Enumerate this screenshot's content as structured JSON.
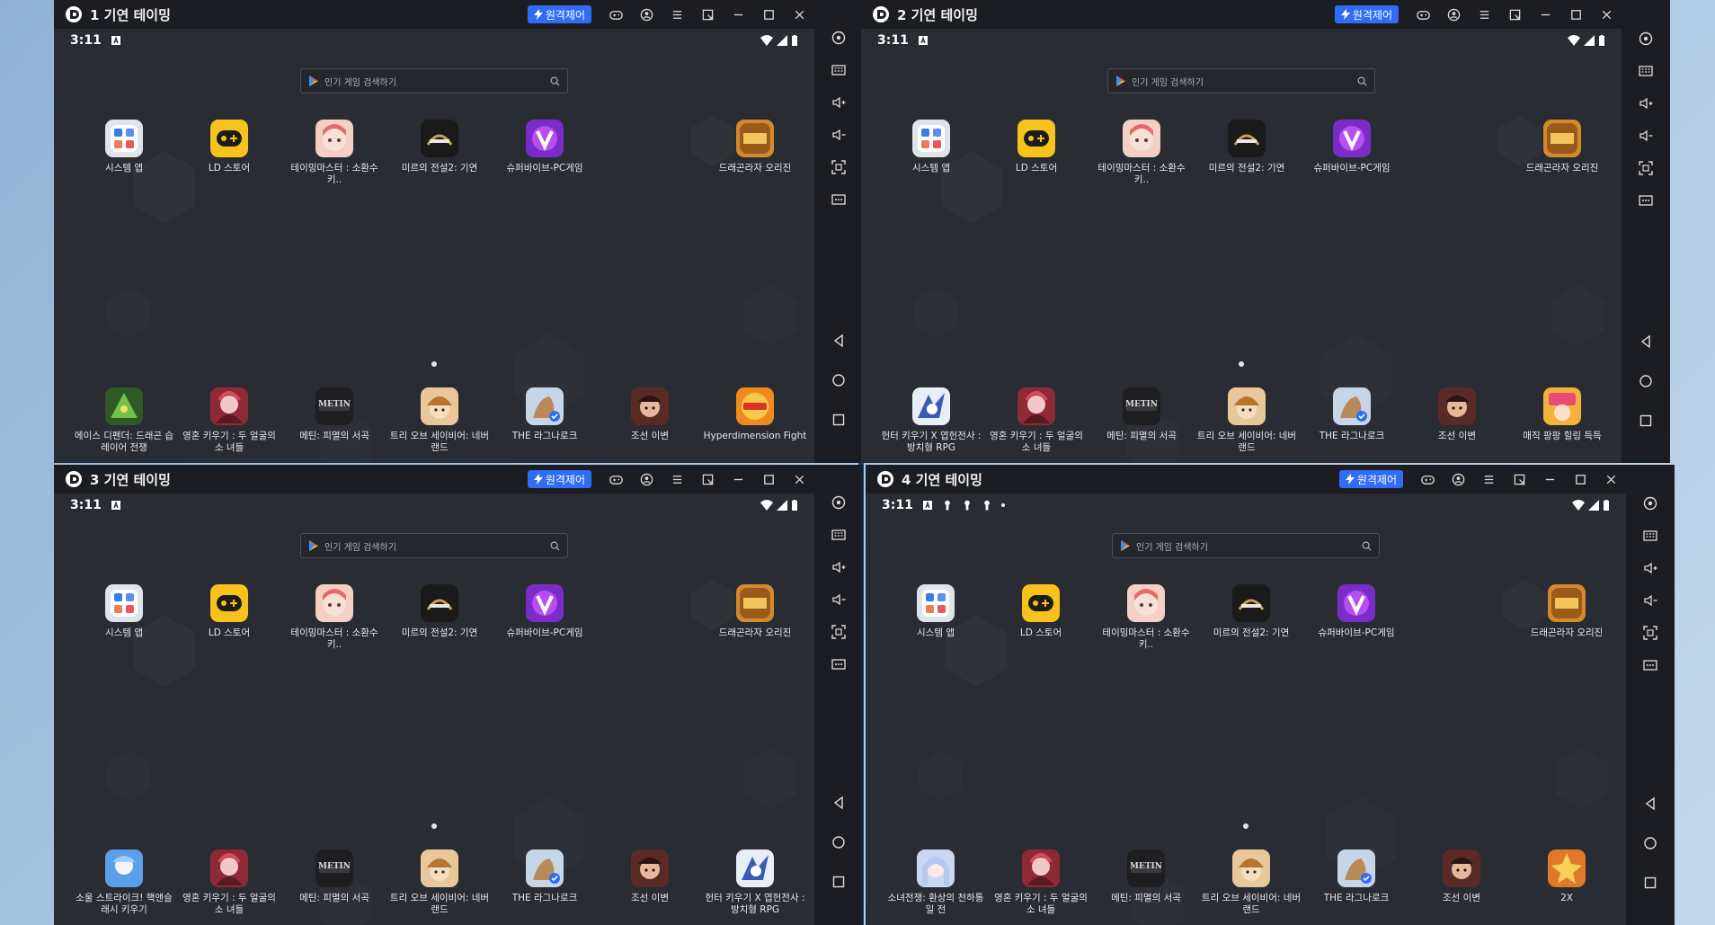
{
  "windows": [
    {
      "title": "1 기연 테이밍",
      "remote_label": "원격제어",
      "time": "3:11",
      "search_placeholder": "인기 게임 검색하기",
      "top_apps": [
        "시스템 앱",
        "LD 스토어",
        "테이밍마스터 : 소환수 키..",
        "미르의 전설2: 기연",
        "슈퍼바이브-PC게임",
        "드래곤라자 오리진"
      ],
      "dock_apps": [
        "에이스 디펜더: 드래곤 습 레이어 전쟁",
        "영혼 키우기 : 두 얼굴의 소 녀들",
        "메틴: 피멸의 서곡",
        "트리 오브 세이비어: 네버 랜드",
        "THE 라그나로크",
        "조선 이변",
        "Hyperdimension Fight"
      ],
      "dock_icons": [
        "dragon",
        "soul",
        "metin",
        "tree",
        "rag",
        "joseon",
        "hyper"
      ]
    },
    {
      "title": "2 기연 테이밍",
      "remote_label": "원격제어",
      "time": "3:11",
      "search_placeholder": "인기 게임 검색하기",
      "top_apps": [
        "시스템 앱",
        "LD 스토어",
        "테이밍마스터 : 소환수 키..",
        "미르의 전설2: 기연",
        "슈퍼바이브-PC게임",
        "드래곤라자 오리진"
      ],
      "dock_apps": [
        "헌터 키우기 X 엽헌전사 : 방치형 RPG",
        "영혼 키우기 : 두 얼굴의 소 녀들",
        "메틴: 피멸의 서곡",
        "트리 오브 세이비어: 네버 랜드",
        "THE 라그나로크",
        "조선 이변",
        "매직 팡팡 힐링 득득"
      ],
      "dock_icons": [
        "hunter",
        "soul",
        "metin",
        "tree",
        "rag",
        "joseon",
        "magic"
      ]
    },
    {
      "title": "3 기연 테이밍",
      "remote_label": "원격제어",
      "time": "3:11",
      "search_placeholder": "인기 게임 검색하기",
      "top_apps": [
        "시스템 앱",
        "LD 스토어",
        "테이밍마스터 : 소환수 키..",
        "미르의 전설2: 기연",
        "슈퍼바이브-PC게임",
        "드래곤라자 오리진"
      ],
      "dock_apps": [
        "소울 스트라이크! 핵앤슬 래시 키우기",
        "영혼 키우기 : 두 얼굴의 소 녀들",
        "메틴: 피멸의 서곡",
        "트리 오브 세이비어: 네버 랜드",
        "THE 라그나로크",
        "조선 이변",
        "헌터 키우기 X 엽헌전사 : 방치형 RPG"
      ],
      "dock_icons": [
        "soulstrike",
        "soul",
        "metin",
        "tree",
        "rag",
        "joseon",
        "hunter"
      ]
    },
    {
      "title": "4 기연 테이밍",
      "remote_label": "원격제어",
      "time": "3:11",
      "search_placeholder": "인기 게임 검색하기",
      "top_apps": [
        "시스템 앱",
        "LD 스토어",
        "테이밍마스터 : 소환수 키..",
        "미르의 전설2: 기연",
        "슈퍼바이브-PC게임",
        "드래곤라자 오리진"
      ],
      "dock_apps": [
        "소녀전쟁: 환상의 천하통일 전",
        "영혼 키우기 : 두 얼굴의 소 녀들",
        "메틴: 피멸의 서곡",
        "트리 오브 세이비어: 네버 랜드",
        "THE 라그나로크",
        "조선 이변",
        "2X"
      ],
      "dock_icons": [
        "girlwar",
        "soul",
        "metin",
        "tree",
        "rag",
        "joseon",
        "twox"
      ]
    }
  ],
  "top_icons": [
    "system",
    "ldstore",
    "taming",
    "mir",
    "supervive",
    "dragonraja"
  ],
  "metin_logo_text": "METIN",
  "colors": {
    "accent": "#2f6df5",
    "titlebar": "#1c1d22",
    "screen": "#2a2c33"
  }
}
